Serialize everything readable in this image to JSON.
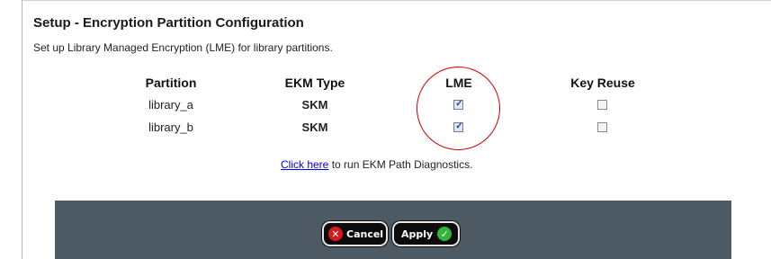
{
  "setup": {
    "title": "Setup - Encryption Partition Configuration",
    "subtitle": "Set up Library Managed Encryption (LME) for library partitions."
  },
  "table": {
    "headers": [
      "Partition",
      "EKM Type",
      "LME",
      "Key Reuse"
    ],
    "rows": [
      {
        "partition": "library_a",
        "ekm_type": "SKM",
        "lme": true,
        "key_reuse": false
      },
      {
        "partition": "library_b",
        "ekm_type": "SKM",
        "lme": true,
        "key_reuse": false
      }
    ]
  },
  "diagnostics": {
    "link_text": "Click here",
    "rest_text": " to run EKM Path Diagnostics."
  },
  "buttons": {
    "cancel_label": "Cancel",
    "apply_label": "Apply"
  },
  "colors": {
    "highlight_circle": "#d40000",
    "footer_bar": "#4d5a63",
    "cancel_icon": "#d61a1a",
    "apply_icon": "#32b33a",
    "link": "#0000ee"
  },
  "icons": {
    "cancel": "x-circle-icon",
    "apply": "check-circle-icon"
  }
}
